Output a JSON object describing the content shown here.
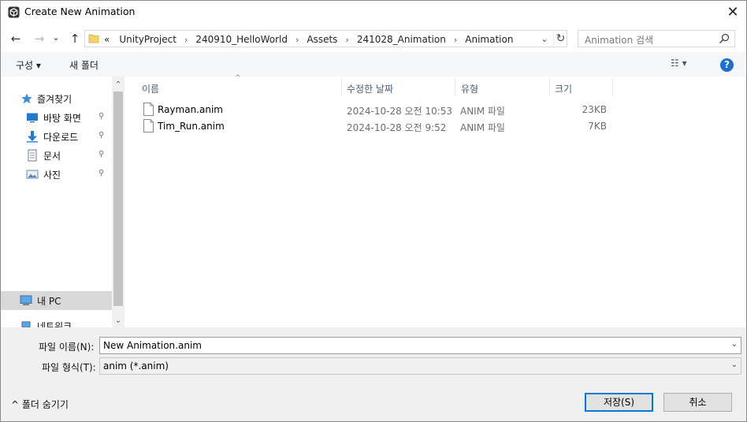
{
  "window": {
    "title": "Create New Animation",
    "close_glyph": "✕"
  },
  "nav": {
    "back_glyph": "←",
    "forward_glyph": "→",
    "recent_glyph": "⌄",
    "up_glyph": "↑",
    "address_overflow": "«",
    "breadcrumbs": [
      "UnityProject",
      "240910_HelloWorld",
      "Assets",
      "241028_Animation",
      "Animation"
    ],
    "breadcrumb_separator": "›",
    "address_dropdown_glyph": "⌄",
    "refresh_glyph": "↻",
    "search_placeholder": "Animation 검색"
  },
  "toolbar": {
    "organize_label": "구성 ▾",
    "new_folder_label": "새 폴더",
    "view_glyph": "☷ ▾",
    "help_glyph": "?"
  },
  "sidebar": {
    "items": [
      {
        "label": "즐겨찾기",
        "icon": "star-icon",
        "pinned": false
      },
      {
        "label": "바탕 화면",
        "icon": "desktop-icon",
        "pinned": true
      },
      {
        "label": "다운로드",
        "icon": "download-icon",
        "pinned": true
      },
      {
        "label": "문서",
        "icon": "document-icon",
        "pinned": true
      },
      {
        "label": "사진",
        "icon": "pictures-icon",
        "pinned": true
      },
      {
        "label": "내 PC",
        "icon": "pc-icon",
        "pinned": false
      },
      {
        "label": "네트워크",
        "icon": "network-icon",
        "pinned": false
      }
    ],
    "pin_glyph": "📌"
  },
  "filelist": {
    "columns": [
      "이름",
      "수정한 날짜",
      "유형",
      "크기"
    ],
    "sort_glyph": "^",
    "rows": [
      {
        "name": "Rayman.anim",
        "date": "2024-10-28 오전 10:53",
        "type": "ANIM 파일",
        "size": "23KB"
      },
      {
        "name": "Tim_Run.anim",
        "date": "2024-10-28 오전 9:52",
        "type": "ANIM 파일",
        "size": "7KB"
      }
    ]
  },
  "bottom": {
    "filename_label": "파일 이름(N):",
    "filename_value": "New Animation.anim",
    "filetype_label": "파일 형식(T):",
    "filetype_value": "anim (*.anim)",
    "dropdown_glyph": "⌄",
    "hide_folders_label": "^  폴더 숨기기",
    "save_label": "저장(S)",
    "cancel_label": "취소"
  },
  "colors": {
    "accent": "#0078d7",
    "selected_nav_bg": "#d9d9d9",
    "help_blue": "#1a6fd1",
    "header_text": "#4c607a"
  }
}
